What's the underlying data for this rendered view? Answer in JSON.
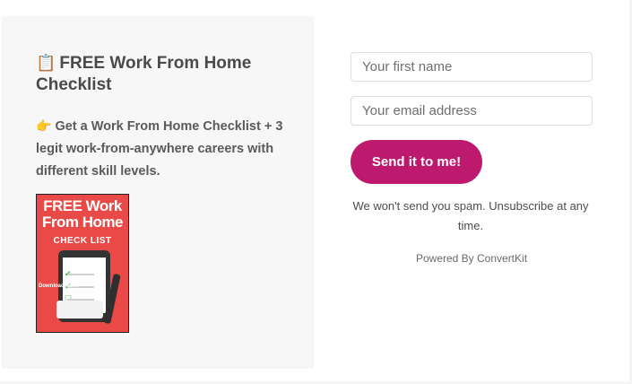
{
  "form": {
    "headline_emoji": "📋",
    "headline": "FREE Work From Home Checklist",
    "subtext_emoji": "👉",
    "subtext": "Get a Work From Home Checklist + 3 legit work-from-anywhere careers with different skill levels.",
    "cover": {
      "title": "FREE Work From Home",
      "subtitle": "CHECK LIST",
      "side_note": "Download Now!"
    },
    "first_name_placeholder": "Your first name",
    "email_placeholder": "Your email address",
    "submit_label": "Send it to me!",
    "disclaimer": "We won't send you spam. Unsubscribe at any time.",
    "powered_by": "Powered By ConvertKit"
  },
  "colors": {
    "accent": "#bd1a6f",
    "panel_bg": "#f7f7f7",
    "cover_bg": "#e94a47"
  }
}
